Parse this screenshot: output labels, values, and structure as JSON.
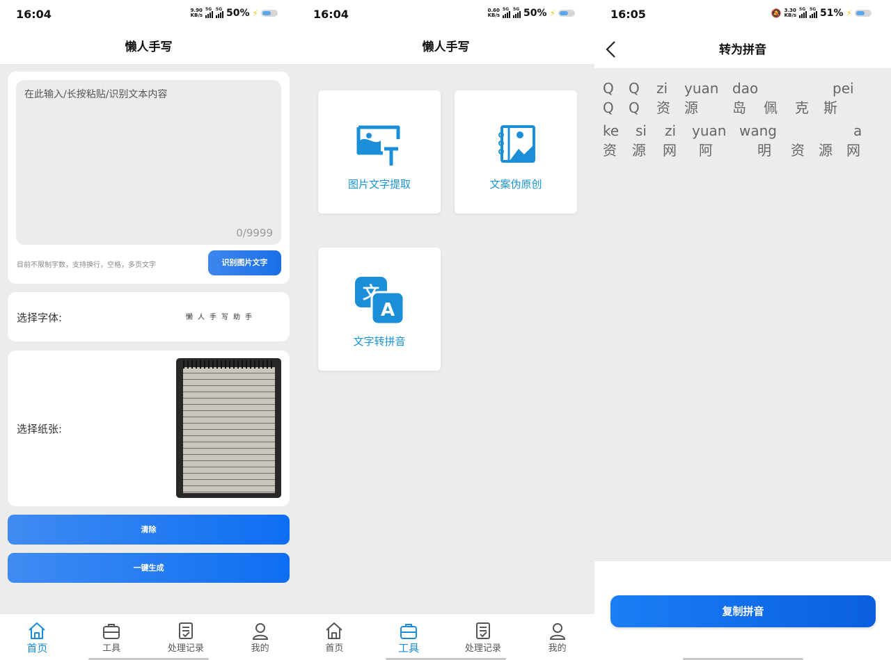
{
  "status": [
    {
      "time": "16:04",
      "speed_top": "9.90",
      "speed_unit": "KB/s",
      "battery": "50%"
    },
    {
      "time": "16:04",
      "speed_top": "0.60",
      "speed_unit": "KB/s",
      "battery": "50%"
    },
    {
      "time": "16:05",
      "speed_top": "3.30",
      "speed_unit": "KB/s",
      "battery": "51%"
    }
  ],
  "network_label": "5G",
  "app_title": "懒人手写",
  "home": {
    "textarea_placeholder": "在此输入/长按粘贴/识别文本内容",
    "char_count": "0/9999",
    "hint": "目前不限制字数，支持换行，空格，多页文字",
    "recognize_button": "识别图片文字",
    "font_label": "选择字体:",
    "font_sample": "懒人手写助手",
    "paper_label": "选择纸张:",
    "clear_button": "清除",
    "generate_button": "一键生成"
  },
  "tools": {
    "items": [
      {
        "label": "图片文字提取",
        "icon": "image-text-extract-icon"
      },
      {
        "label": "文案伪原创",
        "icon": "notebook-image-icon"
      },
      {
        "label": "文字转拼音",
        "icon": "translate-icon"
      }
    ]
  },
  "tabs": [
    {
      "label": "首页",
      "icon": "home-icon"
    },
    {
      "label": "工具",
      "icon": "toolbox-icon"
    },
    {
      "label": "处理记录",
      "icon": "document-check-icon"
    },
    {
      "label": "我的",
      "icon": "user-icon"
    }
  ],
  "pinyin": {
    "title": "转为拼音",
    "lines": [
      {
        "roman": [
          "Q",
          "Q",
          "zi",
          "yuan",
          "dao",
          "",
          "",
          "pei"
        ],
        "hanzi": [
          "Q",
          "Q",
          "资",
          "源",
          "岛",
          "佩",
          "克",
          "斯"
        ]
      },
      {
        "roman": [
          "ke",
          "si",
          "zi",
          "yuan",
          "wang",
          "",
          "",
          "a"
        ],
        "hanzi": [
          "资",
          "源",
          "网",
          "阿",
          "明",
          "资",
          "源",
          "网"
        ]
      }
    ],
    "copy_button": "复制拼音"
  },
  "colors": {
    "accent": "#1a6fe6",
    "tab_active": "#1a8bd8",
    "tile_text": "#1a93d4"
  }
}
